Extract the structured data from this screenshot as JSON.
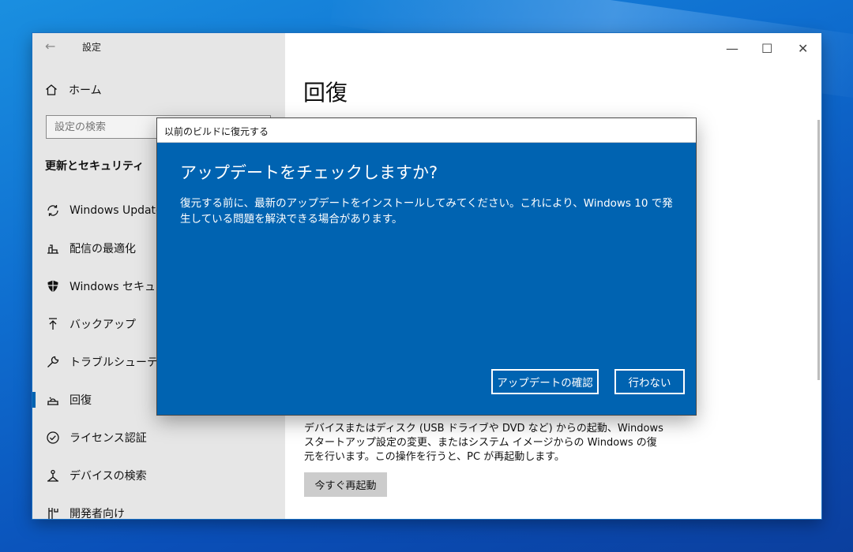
{
  "settings_window": {
    "title": "設定",
    "back_icon": "arrow-left-icon",
    "home_label": "ホーム",
    "search_placeholder": "設定の検索",
    "section_title": "更新とセキュリティ",
    "nav_items": [
      {
        "label": "Windows Update",
        "icon": "sync-icon"
      },
      {
        "label": "配信の最適化",
        "icon": "delivery-optimization-icon"
      },
      {
        "label": "Windows セキュリティ",
        "icon": "shield-icon"
      },
      {
        "label": "バックアップ",
        "icon": "backup-arrow-up-icon"
      },
      {
        "label": "トラブルシューティング",
        "icon": "wrench-icon"
      },
      {
        "label": "回復",
        "icon": "recovery-icon",
        "active": true
      },
      {
        "label": "ライセンス認証",
        "icon": "check-circle-icon"
      },
      {
        "label": "デバイスの検索",
        "icon": "find-device-icon"
      },
      {
        "label": "開発者向け",
        "icon": "developer-icon"
      }
    ],
    "window_controls": {
      "minimize": "—",
      "maximize": "☐",
      "close": "✕"
    }
  },
  "content": {
    "page_title": "回復",
    "advanced_startup_text": "デバイスまたはディスク (USB ドライブや DVD など) からの起動、Windows スタートアップ設定の変更、またはシステム イメージからの Windows の復元を行います。この操作を行うと、PC が再起動します。",
    "restart_button": "今すぐ再起動"
  },
  "dialog": {
    "title": "以前のビルドに復元する",
    "heading": "アップデートをチェックしますか?",
    "body": "復元する前に、最新のアップデートをインストールしてみてください。これにより、Windows 10 で発生している問題を解決できる場合があります。",
    "check_button": "アップデートの確認",
    "no_button": "行わない"
  },
  "colors": {
    "accent": "#0063b1",
    "sidebar_bg": "#e6e6e6",
    "window_bg": "#ffffff"
  }
}
